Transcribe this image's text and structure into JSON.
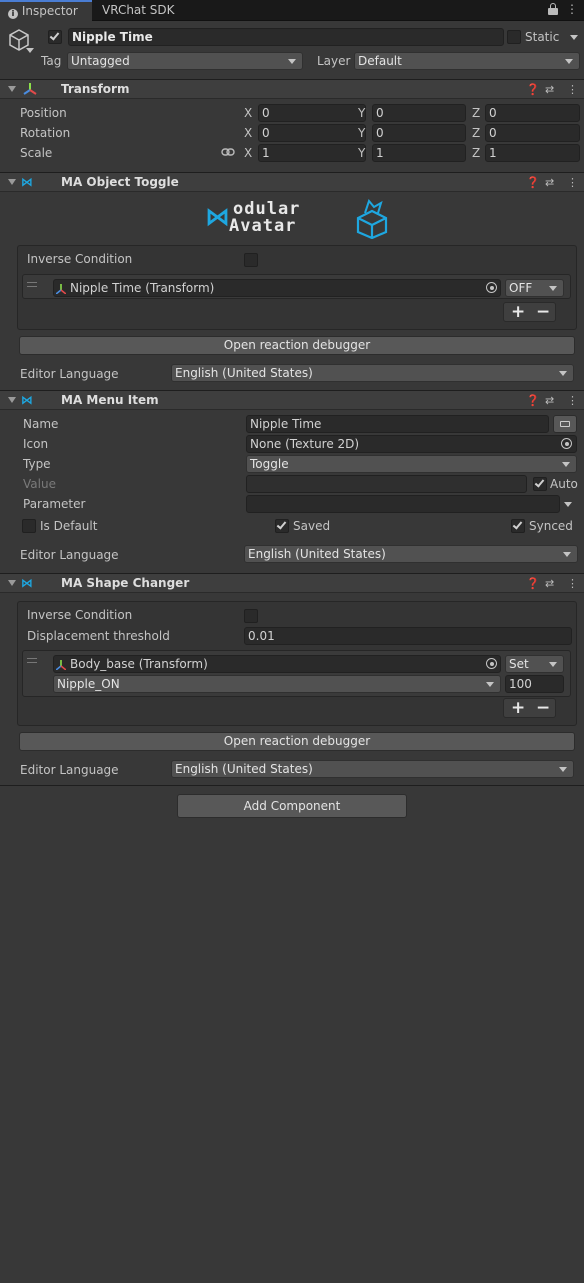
{
  "tabs": {
    "inspector": "Inspector",
    "vrchat_sdk": "VRChat SDK"
  },
  "header": {
    "name": "Nipple Time",
    "static_label": "Static",
    "tag_label": "Tag",
    "tag_value": "Untagged",
    "layer_label": "Layer",
    "layer_value": "Default"
  },
  "transform": {
    "title": "Transform",
    "rows": [
      {
        "label": "Position",
        "x": "0",
        "y": "0",
        "z": "0"
      },
      {
        "label": "Rotation",
        "x": "0",
        "y": "0",
        "z": "0"
      },
      {
        "label": "Scale",
        "x": "1",
        "y": "1",
        "z": "1"
      }
    ],
    "axis": {
      "x": "X",
      "y": "Y",
      "z": "Z"
    }
  },
  "object_toggle": {
    "title": "MA Object Toggle",
    "logo_line1": "odular",
    "logo_line2": "Avatar",
    "inverse_label": "Inverse Condition",
    "entry_object": "Nipple Time (Transform)",
    "entry_state": "OFF",
    "plus": "+",
    "minus": "−",
    "debugger": "Open reaction debugger",
    "lang_label": "Editor Language",
    "lang_value": "English (United States)"
  },
  "menu_item": {
    "title": "MA Menu Item",
    "name_label": "Name",
    "name_value": "Nipple Time",
    "icon_label": "Icon",
    "icon_value": "None (Texture 2D)",
    "type_label": "Type",
    "type_value": "Toggle",
    "value_label": "Value",
    "auto_label": "Auto",
    "param_label": "Parameter",
    "default_label": "Is Default",
    "saved_label": "Saved",
    "synced_label": "Synced",
    "lang_label": "Editor Language",
    "lang_value": "English (United States)"
  },
  "shape_changer": {
    "title": "MA Shape Changer",
    "inverse_label": "Inverse Condition",
    "threshold_label": "Displacement threshold",
    "threshold_value": "0.01",
    "entry_object": "Body_base (Transform)",
    "entry_mode": "Set",
    "entry_shape": "Nipple_ON",
    "entry_value": "100",
    "plus": "+",
    "minus": "−",
    "debugger": "Open reaction debugger",
    "lang_label": "Editor Language",
    "lang_value": "English (United States)"
  },
  "add_component": "Add Component",
  "colors": {
    "accent": "#4a7dd3",
    "ma_blue": "#1ea7e0"
  }
}
